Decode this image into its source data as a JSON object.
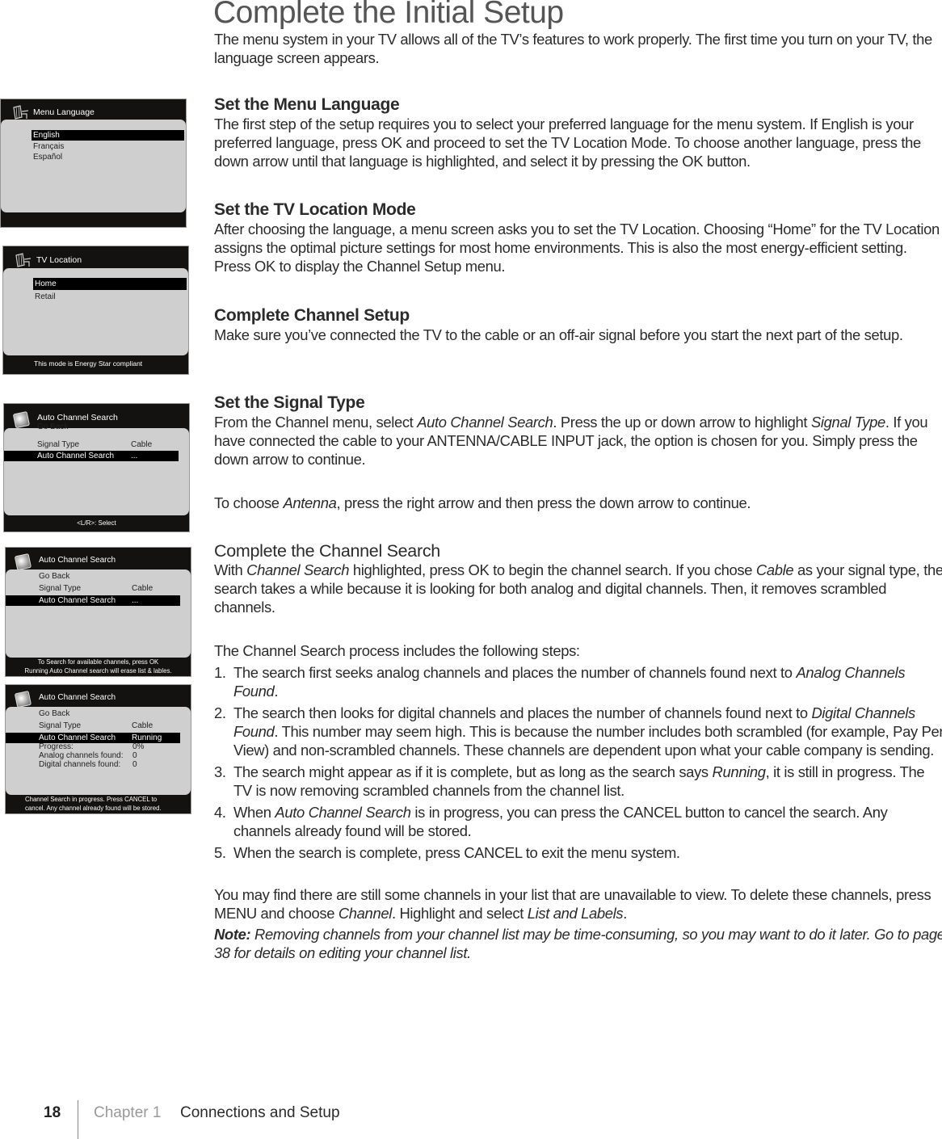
{
  "page": {
    "title": "Complete the Initial Setup",
    "intro": "The menu system in your TV allows all of the TV’s features to work properly. The first time you turn on your TV, the language screen appears."
  },
  "sections": {
    "menu_language": {
      "heading": "Set the Menu Language",
      "body": "The first step of the setup requires you to select your preferred language for the menu system. If English is your preferred language, press OK and proceed to set the TV Location Mode. To choose another language, press the down arrow until that language is highlighted, and select it by pressing the OK button."
    },
    "location_mode": {
      "heading": "Set the TV Location Mode",
      "body": "After choosing the language, a menu screen asks you to set the TV Location. Choosing “Home” for the TV Location assigns the optimal picture settings for most home environments. This is also the most energy-efficient setting. Press OK to display the Channel Setup menu."
    },
    "channel_setup": {
      "heading": "Complete Channel Setup",
      "body": "Make sure you’ve connected the TV to the cable or an off-air signal before you start the next part of the setup."
    },
    "signal_type": {
      "heading": "Set the Signal Type",
      "body_1a": "From the Channel menu, select ",
      "body_1b": "Auto Channel Search",
      "body_1c": ". Press the up or down arrow to highlight ",
      "body_1d": "Signal Type",
      "body_1e": ". If you have connected the cable to your ANTENNA/CABLE INPUT jack, the option is chosen for you. Simply press the down arrow to continue.",
      "body_2a": "To choose ",
      "body_2b": "Antenna",
      "body_2c": ", press the right arrow and then press the down arrow to continue."
    },
    "channel_search": {
      "heading": "Complete the Channel Search",
      "body_a": "With ",
      "body_b": "Channel Search",
      "body_c": " highlighted, press OK to begin the channel search. If you chose ",
      "body_d": "Cable",
      "body_e": " as your signal type, the search takes a while because it is looking for both analog and digital channels. Then, it removes scrambled channels.",
      "steps_intro": "The Channel Search process includes the following steps:",
      "steps": [
        {
          "num": "1.",
          "a": "The search first seeks analog channels and places the number of channels found next to ",
          "b": "Analog Channels Found",
          "c": "."
        },
        {
          "num": "2.",
          "a": "The search then looks for digital channels and places the number of channels found next to ",
          "b": "Digital Channels Found",
          "c": ". This number may seem high. This is because the number includes both scrambled (for example, Pay Per View) and non-scrambled channels. These channels are dependent upon what your cable company is sending."
        },
        {
          "num": "3.",
          "a": "The search might appear as if it is complete, but as long as the search says ",
          "b": "Running",
          "c": ", it is still in progress. The TV is now removing scrambled channels from the channel list."
        },
        {
          "num": "4.",
          "a": "When ",
          "b": "Auto Channel Search",
          "c": " is in progress, you can press the CANCEL button to cancel the search. Any channels already found will be stored."
        },
        {
          "num": "5.",
          "a": "When the search is complete, press CANCEL to exit the menu system.",
          "b": "",
          "c": ""
        }
      ],
      "closing_a": "You may find there are still some channels in your list that are unavailable to view. To delete these channels, press MENU and choose ",
      "closing_b": "Channel",
      "closing_c": ". Highlight and select ",
      "closing_d": "List and Labels",
      "closing_e": ".",
      "note_label": "Note:",
      "note_text": " Removing channels from your channel list may be time-consuming, so you may want to do it later. Go to page 38 for details on editing your channel list."
    }
  },
  "screens": {
    "language": {
      "icon": "plug-icon",
      "title": "Menu Language",
      "options": [
        "English",
        "Français",
        "Español"
      ],
      "selected": "English"
    },
    "location": {
      "icon": "plug-icon",
      "title": "TV Location",
      "options": [
        "Home",
        "Retail"
      ],
      "selected": "Home",
      "footer": "This mode is Energy Star compliant"
    },
    "signal": {
      "icon": "channel-icon",
      "title": "Auto Channel Search",
      "rows": [
        {
          "label": "Go Back",
          "value": ""
        },
        {
          "label": "Signal Type",
          "value": "Cable"
        },
        {
          "label": "Auto Channel Search",
          "value": "..."
        }
      ],
      "footer": "<L/R>: Select"
    },
    "search_ready": {
      "icon": "channel-icon",
      "title": "Auto Channel Search",
      "rows": [
        {
          "label": "Go Back",
          "value": ""
        },
        {
          "label": "Signal Type",
          "value": "Cable"
        },
        {
          "label": "Auto Channel Search",
          "value": "..."
        }
      ],
      "footer_1": "To Search for available channels, press OK",
      "footer_2": "Running Auto Channel search will erase list & lables."
    },
    "search_running": {
      "icon": "channel-icon",
      "title": "Auto Channel Search",
      "rows": [
        {
          "label": "Go Back",
          "value": ""
        },
        {
          "label": "Signal Type",
          "value": "Cable"
        },
        {
          "label": "Auto Channel Search",
          "value": "Running"
        },
        {
          "label": "Progress:",
          "value": "0%"
        },
        {
          "label": "Analog channels found:",
          "value": "0"
        },
        {
          "label": "Digital channels found:",
          "value": "0"
        }
      ],
      "progress_percent": 0,
      "footer_1": "Channel Search in progress. Press CANCEL to",
      "footer_2": "cancel. Any channel already found will be stored."
    }
  },
  "footer": {
    "page_number": "18",
    "chapter": "Chapter 1",
    "chapter_title": "Connections and Setup"
  }
}
